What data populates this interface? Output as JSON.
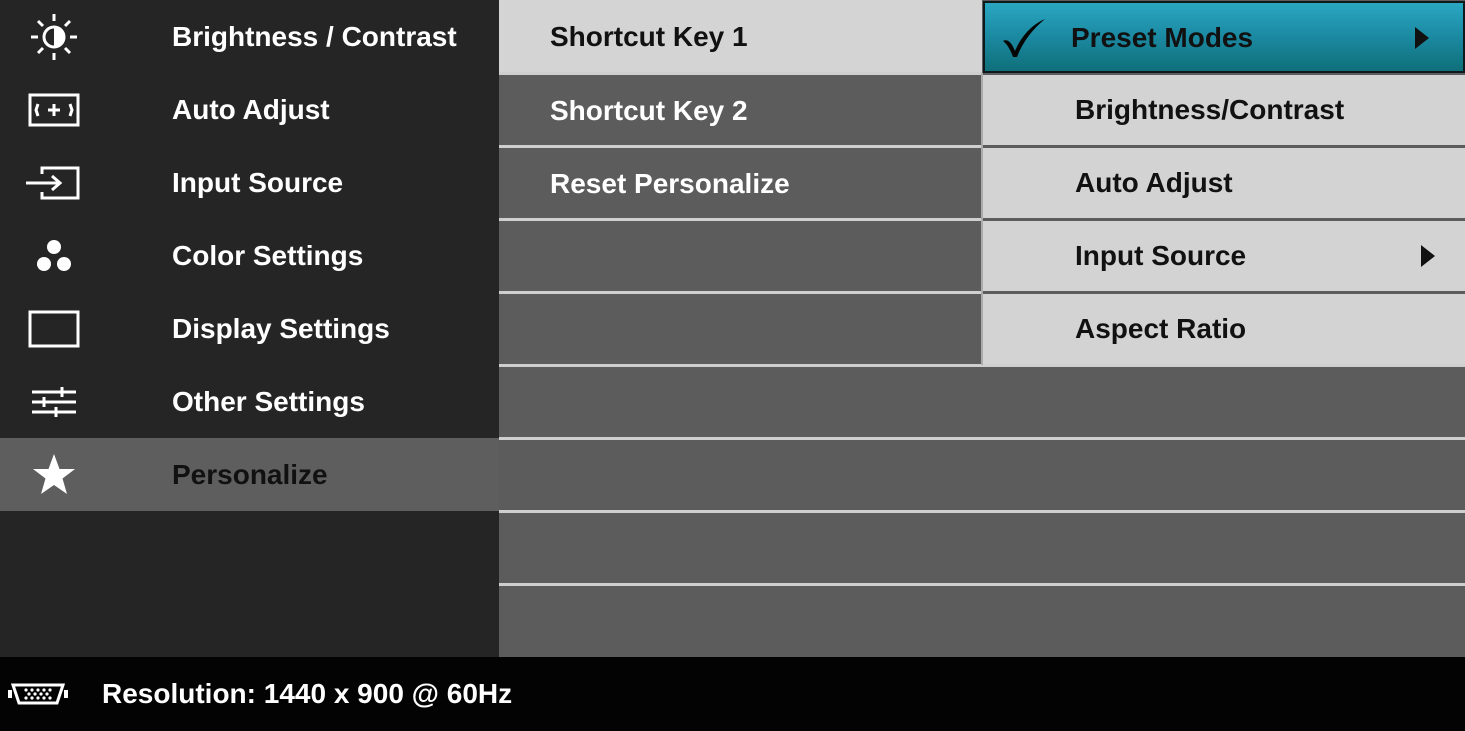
{
  "sidebar": {
    "items": [
      {
        "label": "Brightness / Contrast",
        "icon": "brightness-icon"
      },
      {
        "label": "Auto Adjust",
        "icon": "auto-adjust-icon"
      },
      {
        "label": "Input Source",
        "icon": "input-source-icon"
      },
      {
        "label": "Color Settings",
        "icon": "color-settings-icon"
      },
      {
        "label": "Display Settings",
        "icon": "display-settings-icon"
      },
      {
        "label": "Other Settings",
        "icon": "other-settings-icon"
      },
      {
        "label": "Personalize",
        "icon": "star-icon",
        "active": true
      }
    ]
  },
  "submenu": {
    "items": [
      {
        "label": "Shortcut Key 1",
        "selected": true
      },
      {
        "label": "Shortcut Key 2"
      },
      {
        "label": "Reset Personalize"
      }
    ]
  },
  "options": {
    "items": [
      {
        "label": "Preset Modes",
        "checked": true,
        "has_submenu": true
      },
      {
        "label": "Brightness/Contrast"
      },
      {
        "label": "Auto Adjust"
      },
      {
        "label": "Input Source",
        "has_submenu": true
      },
      {
        "label": "Aspect Ratio"
      }
    ]
  },
  "footer": {
    "resolution_text": "Resolution: 1440 x 900 @ 60Hz",
    "icon": "vga-connector-icon"
  },
  "colors": {
    "sidebar_bg": "#252525",
    "content_bg": "#5c5c5c",
    "highlight_gradient_top": "#2aa7c2",
    "highlight_gradient_bottom": "#0f6f79",
    "option_bg": "#d3d3d3"
  }
}
